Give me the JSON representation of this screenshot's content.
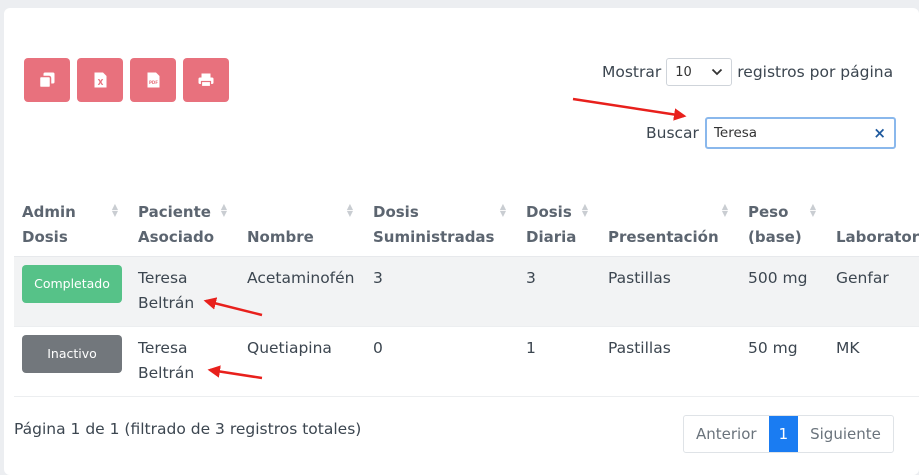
{
  "export_buttons": [
    {
      "icon": "copy-icon"
    },
    {
      "icon": "excel-icon",
      "label": "X"
    },
    {
      "icon": "pdf-icon",
      "label": "PDF"
    },
    {
      "icon": "print-icon"
    }
  ],
  "length": {
    "prefix": "Mostrar",
    "value": "10",
    "suffix": "registros por página"
  },
  "search": {
    "label": "Buscar",
    "value": "Teresa",
    "clear": "×"
  },
  "table": {
    "columns": [
      {
        "line1": "Admin",
        "line2": "Dosis"
      },
      {
        "line1": "Paciente",
        "line2": "Asociado"
      },
      {
        "line1": "",
        "line2": "Nombre"
      },
      {
        "line1": "Dosis",
        "line2": "Suministradas"
      },
      {
        "line1": "Dosis",
        "line2": "Diaria"
      },
      {
        "line1": "",
        "line2": "Presentación"
      },
      {
        "line1": "Peso",
        "line2": "(base)"
      },
      {
        "line1": "",
        "line2": "Laboratorio"
      }
    ],
    "rows": [
      {
        "status": "Completado",
        "status_color": "#56c288",
        "paciente_1": "Teresa",
        "paciente_2": "Beltrán",
        "nombre": "Acetaminofén",
        "suministradas": "3",
        "diaria": "3",
        "presentacion": "Pastillas",
        "peso": "500 mg",
        "laboratorio": "Genfar"
      },
      {
        "status": "Inactivo",
        "status_color": "#72777c",
        "paciente_1": "Teresa",
        "paciente_2": "Beltrán",
        "nombre": "Quetiapina",
        "suministradas": "0",
        "diaria": "1",
        "presentacion": "Pastillas",
        "peso": "50 mg",
        "laboratorio": "MK"
      }
    ]
  },
  "info": "Página 1 de 1 (filtrado de 3 registros totales)",
  "pagination": {
    "previous": "Anterior",
    "current": "1",
    "next": "Siguiente"
  },
  "colors": {
    "export_button": "#e8717d",
    "active_page": "#1a7cf2",
    "annotation_arrow": "#e8201c"
  }
}
